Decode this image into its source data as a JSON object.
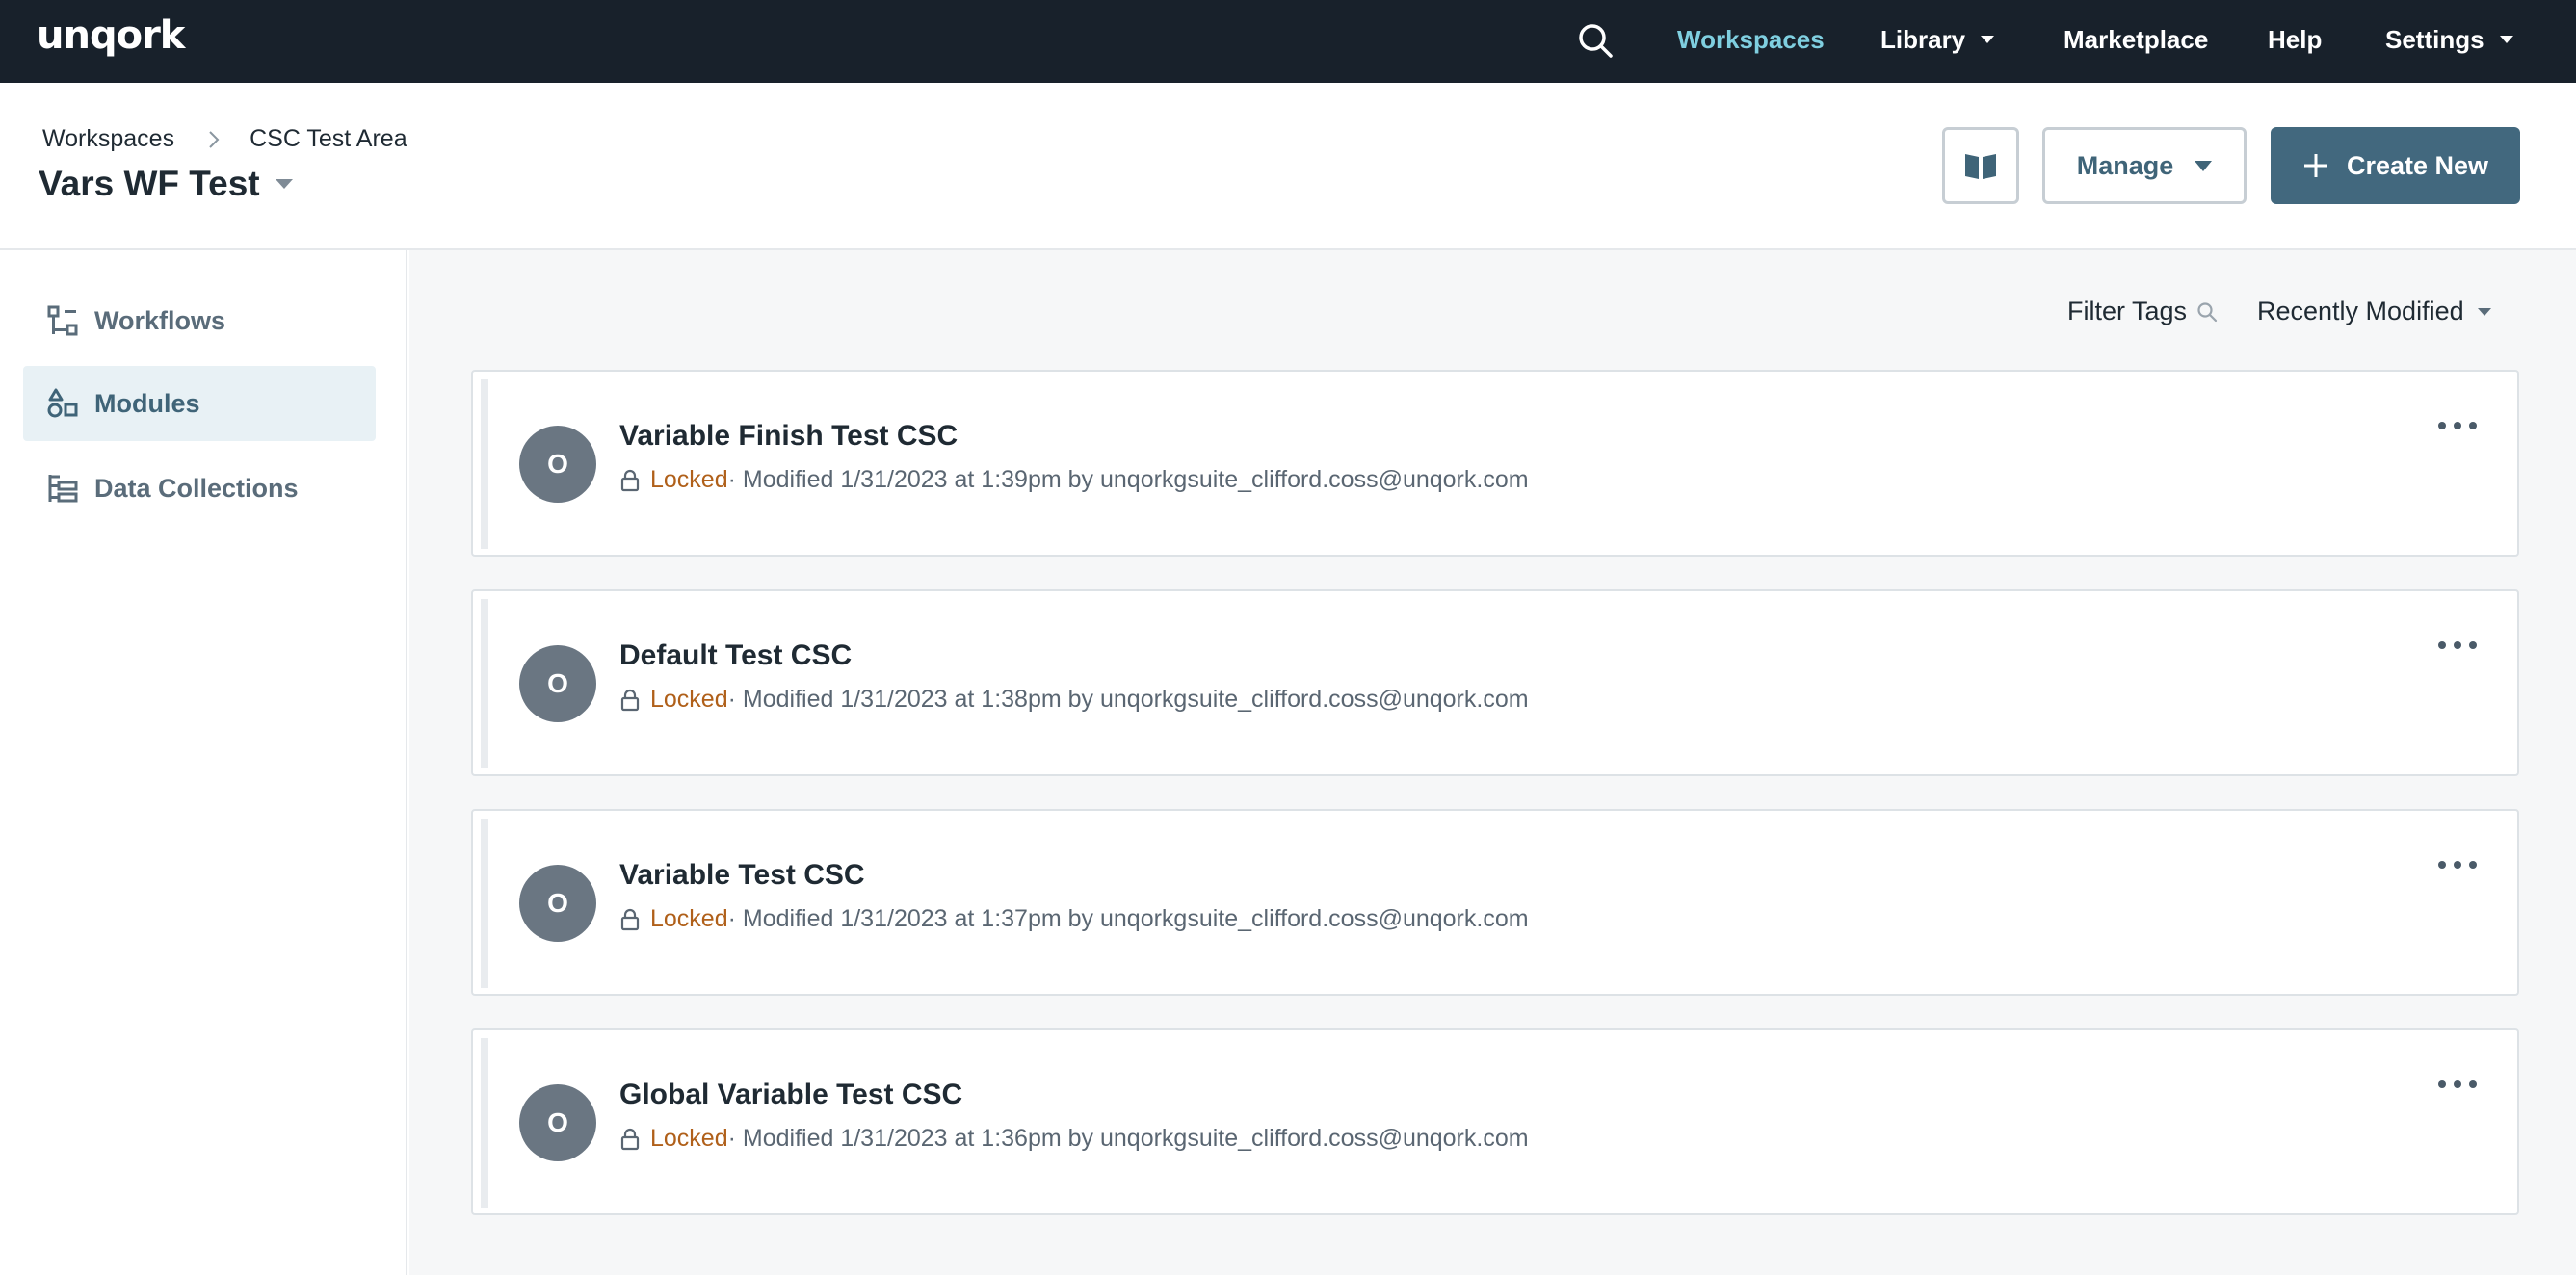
{
  "nav": {
    "logo": "unqork",
    "items": [
      {
        "label": "Workspaces",
        "active": true
      },
      {
        "label": "Library",
        "dropdown": true
      },
      {
        "label": "Marketplace"
      },
      {
        "label": "Help"
      },
      {
        "label": "Settings",
        "dropdown": true
      }
    ],
    "search_icon": "search-icon"
  },
  "header": {
    "breadcrumb": [
      "Workspaces",
      "CSC Test Area"
    ],
    "title": "Vars WF Test",
    "docs_icon": "book-icon",
    "manage_label": "Manage",
    "create_label": "Create New"
  },
  "sidebar": {
    "items": [
      {
        "label": "Workflows",
        "icon": "workflow-icon",
        "active": false
      },
      {
        "label": "Modules",
        "icon": "modules-icon",
        "active": true
      },
      {
        "label": "Data Collections",
        "icon": "data-collections-icon",
        "active": false
      }
    ]
  },
  "toolbar": {
    "filter_label": "Filter Tags",
    "sort_label": "Recently Modified"
  },
  "modules": [
    {
      "initial": "O",
      "name": "Variable Finish Test CSC",
      "status": "Locked",
      "modified": " · Modified 1/31/2023 at 1:39pm by unqorkgsuite_clifford.coss@unqork.com"
    },
    {
      "initial": "O",
      "name": "Default Test CSC",
      "status": "Locked",
      "modified": " · Modified 1/31/2023 at 1:38pm by unqorkgsuite_clifford.coss@unqork.com"
    },
    {
      "initial": "O",
      "name": "Variable Test CSC",
      "status": "Locked",
      "modified": " · Modified 1/31/2023 at 1:37pm by unqorkgsuite_clifford.coss@unqork.com"
    },
    {
      "initial": "O",
      "name": "Global Variable Test CSC",
      "status": "Locked",
      "modified": " · Modified 1/31/2023 at 1:36pm by unqorkgsuite_clifford.coss@unqork.com"
    }
  ],
  "colors": {
    "nav_bg": "#18212b",
    "nav_active": "#7fcfe0",
    "primary": "#42687e",
    "locked": "#b0601a"
  }
}
